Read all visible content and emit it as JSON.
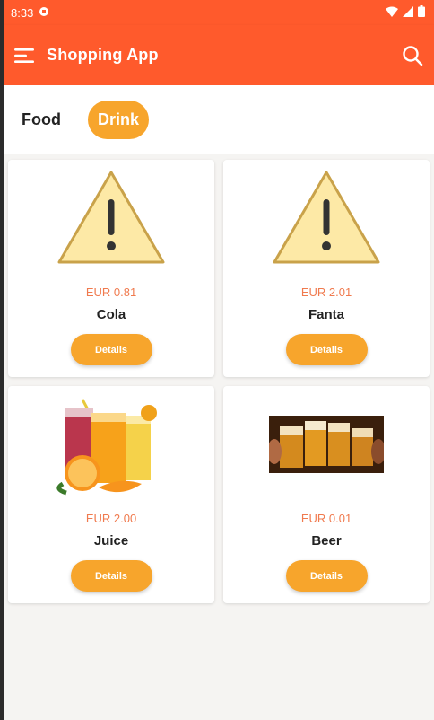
{
  "status": {
    "time": "8:33"
  },
  "appbar": {
    "title": "Shopping App"
  },
  "tabs": [
    {
      "label": "Food",
      "active": false
    },
    {
      "label": "Drink",
      "active": true
    }
  ],
  "products": [
    {
      "name": "Cola",
      "price": "EUR 0.81",
      "image": "warning-icon",
      "button": "Details"
    },
    {
      "name": "Fanta",
      "price": "EUR 2.01",
      "image": "warning-icon",
      "button": "Details"
    },
    {
      "name": "Juice",
      "price": "EUR 2.00",
      "image": "juice-image",
      "button": "Details"
    },
    {
      "name": "Beer",
      "price": "EUR 0.01",
      "image": "beer-image",
      "button": "Details"
    }
  ],
  "colors": {
    "appbar": "#ff5a2c",
    "accent": "#f7a52c",
    "price": "#f07a4e"
  }
}
